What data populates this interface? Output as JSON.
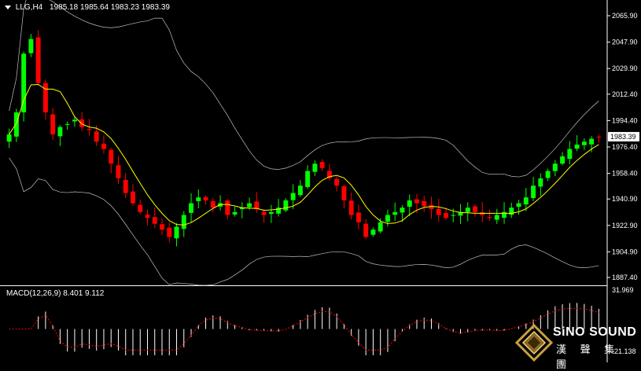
{
  "header": {
    "symbol": "LLG,H4",
    "ohlc": "1985.18 1985.64 1983.23 1983.39"
  },
  "macd_label": "MACD(12,26,9) 8.401 9.112",
  "current_price": "1983.39",
  "logo": {
    "name": "SiNO SOUND",
    "chinese": "漢 聲 集 團"
  },
  "colors": {
    "background": "#000000",
    "bull": "#00ff00",
    "bear": "#ff0000",
    "sma": "#ffff00",
    "bands": "#c0c0c0",
    "macd_hist": "#ffffff",
    "macd_signal": "#ff0000"
  },
  "chart_data": {
    "type": "candlestick",
    "title": "LLG,H4",
    "y_ticks": [
      "2065.90",
      "2047.90",
      "2029.90",
      "2012.40",
      "1994.40",
      "1976.40",
      "1958.40",
      "1940.90",
      "1922.90",
      "1904.90",
      "1887.40"
    ],
    "ylim": [
      1887.4,
      2065.9
    ],
    "indicators": [
      "Bollinger Bands (20)",
      "SMA",
      "MACD(12,26,9)"
    ],
    "closes": [
      1985,
      2000,
      2040,
      2050,
      2020,
      2000,
      1985,
      1990,
      1992,
      1995,
      1990,
      1988,
      1980,
      1975,
      1965,
      1955,
      1945,
      1938,
      1932,
      1928,
      1924,
      1920,
      1915,
      1922,
      1930,
      1938,
      1942,
      1940,
      1935,
      1938,
      1930,
      1932,
      1935,
      1938,
      1934,
      1930,
      1932,
      1935,
      1940,
      1945,
      1950,
      1960,
      1965,
      1962,
      1955,
      1950,
      1940,
      1930,
      1925,
      1915,
      1920,
      1925,
      1930,
      1932,
      1935,
      1940,
      1938,
      1936,
      1934,
      1930,
      1928,
      1930,
      1932,
      1935,
      1932,
      1930,
      1928,
      1930,
      1932,
      1935,
      1938,
      1942,
      1950,
      1955,
      1960,
      1965,
      1970,
      1975,
      1978,
      1980,
      1982,
      1983.39
    ],
    "macd": {
      "label": "MACD(12,26,9)",
      "value": 8.401,
      "signal": 9.112,
      "ymax": 31.969,
      "ymin": -21.138,
      "ticks": [
        "31.969",
        "-21.138"
      ]
    }
  }
}
